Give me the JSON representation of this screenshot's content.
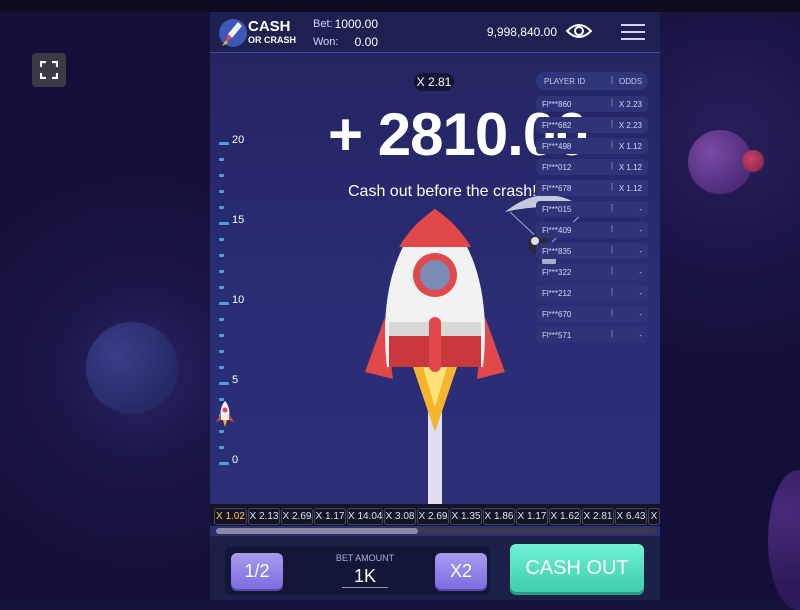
{
  "header": {
    "logo_title": "CASH",
    "logo_subtitle": "OR CRASH",
    "bet_label": "Bet:",
    "bet_value": "1000.00",
    "won_label": "Won:",
    "won_value": "0.00",
    "balance": "9,998,840.00"
  },
  "game": {
    "current_odds": "X 2.81",
    "win_amount": "+ 2810.00",
    "message": "Cash out before the crash!",
    "altitude_scale": [
      "20",
      "15",
      "10",
      "5",
      "0"
    ],
    "altitude_progress": 0.05
  },
  "players": {
    "col_id": "PLAYER ID",
    "col_odds": "ODDS",
    "rows": [
      {
        "id": "Fl***860",
        "odds": "X 2.23"
      },
      {
        "id": "Fl***682",
        "odds": "X 2.23"
      },
      {
        "id": "Fl***498",
        "odds": "X 1.12"
      },
      {
        "id": "Fl***012",
        "odds": "X 1.12"
      },
      {
        "id": "Fl***678",
        "odds": "X 1.12"
      },
      {
        "id": "Fl***015",
        "odds": "-"
      },
      {
        "id": "Fl***409",
        "odds": "-"
      },
      {
        "id": "Fl***835",
        "odds": "-"
      },
      {
        "id": "Fl***322",
        "odds": "-"
      },
      {
        "id": "Fl***212",
        "odds": "-"
      },
      {
        "id": "Fl***670",
        "odds": "-"
      },
      {
        "id": "Fl***571",
        "odds": "-"
      }
    ]
  },
  "history": [
    "X 1.02",
    "X 2.13",
    "X 2.69",
    "X 1.17",
    "X 14.04",
    "X 3.08",
    "X 2.69",
    "X 1.35",
    "X 1.86",
    "X 1.17",
    "X 1.62",
    "X 2.81",
    "X 6.43",
    "X"
  ],
  "controls": {
    "half_label": "1/2",
    "bet_amount_label": "BET AMOUNT",
    "bet_amount_value": "1K",
    "double_label": "X2",
    "cashout_label": "CASH OUT"
  },
  "colors": {
    "accent_teal": "#4fdcbb",
    "accent_purple": "#8e80e8",
    "rocket_red": "#e0484a",
    "history_gold": "#ffc94a"
  }
}
